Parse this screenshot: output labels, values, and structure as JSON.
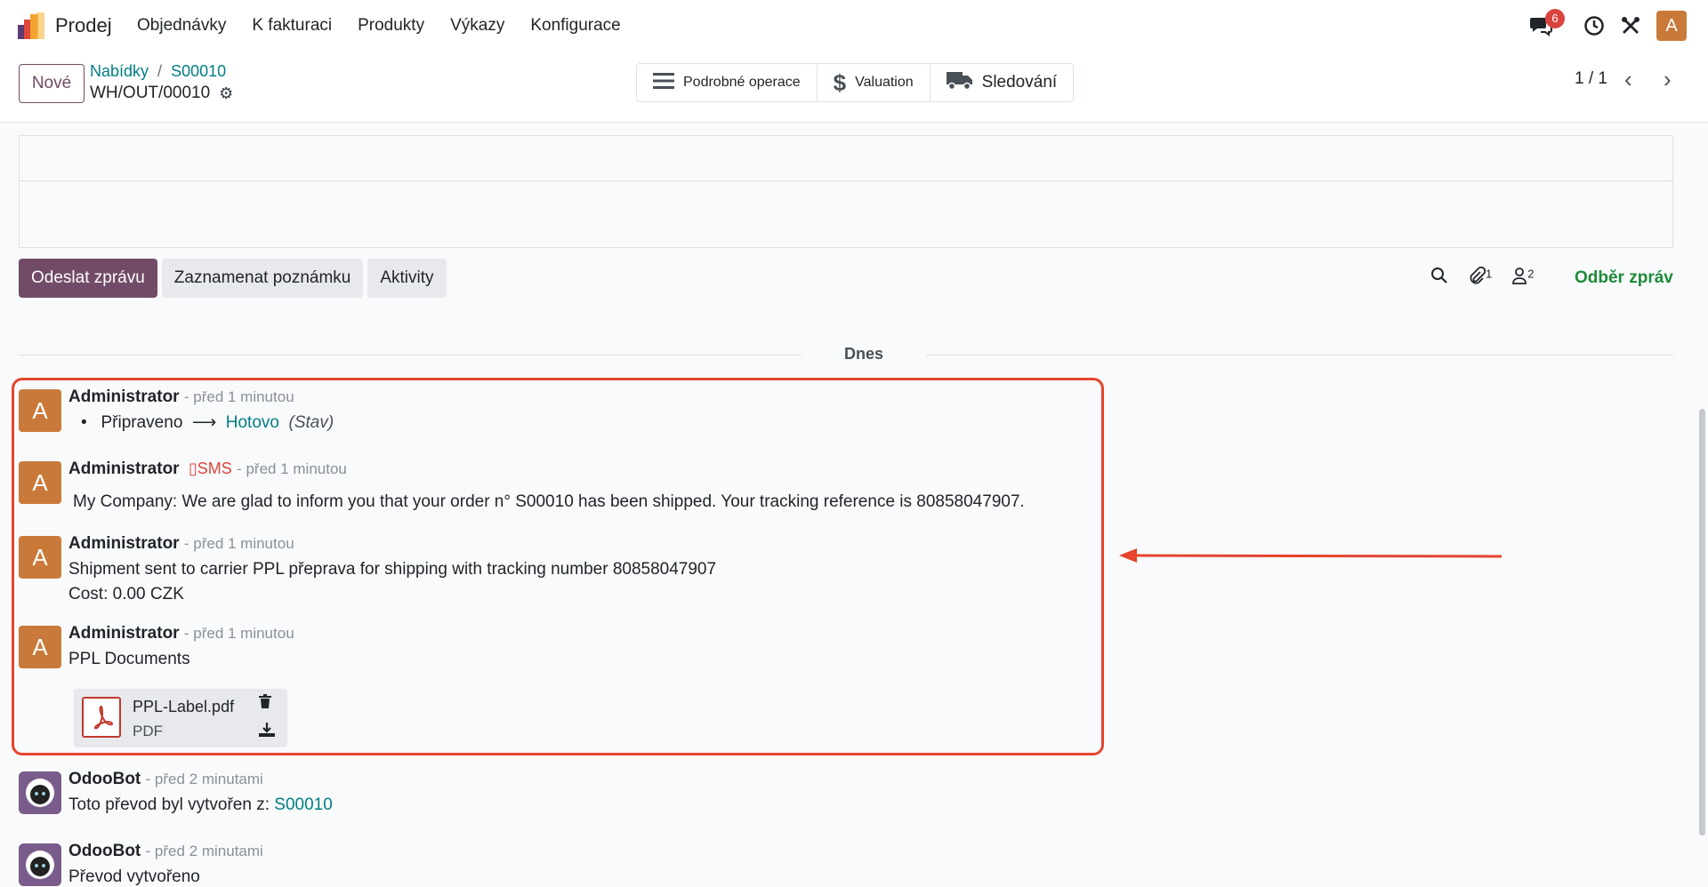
{
  "navbar": {
    "app_name": "Prodej",
    "menu": [
      "Objednávky",
      "K fakturaci",
      "Produkty",
      "Výkazy",
      "Konfigurace"
    ],
    "messages_badge": "6",
    "user_initial": "A"
  },
  "control": {
    "new_label": "Nové",
    "breadcrumb": [
      "Nabídky",
      "S00010"
    ],
    "breadcrumb_sep": "/",
    "record_name": "WH/OUT/00010",
    "smart_buttons": [
      "Podrobné operace",
      "Valuation",
      "Sledování"
    ],
    "pager": "1 / 1"
  },
  "chatter": {
    "send_message": "Odeslat zprávu",
    "log_note": "Zaznamenat poznámku",
    "activities": "Aktivity",
    "attachments_count": "1",
    "followers_count": "2",
    "follow_label": "Odběr zpráv",
    "date_separator": "Dnes"
  },
  "messages": [
    {
      "initial": "A",
      "author": "Administrator",
      "time": "- před 1 minutou",
      "tracking_old": "Připraveno",
      "tracking_arrow": "⟶",
      "tracking_new": "Hotovo",
      "tracking_field": "(Stav)"
    },
    {
      "initial": "A",
      "author": "Administrator",
      "sms": "SMS",
      "time": "- před 1 minutou",
      "body": "My Company: We are glad to inform you that your order n° S00010 has been shipped. Your tracking reference is 80858047907."
    },
    {
      "initial": "A",
      "author": "Administrator",
      "time": "- před 1 minutou",
      "line1": "Shipment sent to carrier PPL přeprava for shipping with tracking number 80858047907",
      "line2": "Cost: 0.00 CZK"
    },
    {
      "initial": "A",
      "author": "Administrator",
      "time": "- před 1 minutou",
      "body": "PPL Documents",
      "attachment_name": "PPL-Label.pdf",
      "attachment_type": "PDF"
    },
    {
      "author": "OdooBot",
      "time": "- před 2 minutami",
      "body_prefix": "Toto převod byl vytvořen z:",
      "body_link": "S00010"
    },
    {
      "author": "OdooBot",
      "time": "- před 2 minutami",
      "body": "Převod vytvořeno"
    }
  ],
  "colors": {
    "primary": "#714b67",
    "link": "#017e84",
    "highlight": "#e5442d",
    "avatar": "#c97a3a"
  }
}
